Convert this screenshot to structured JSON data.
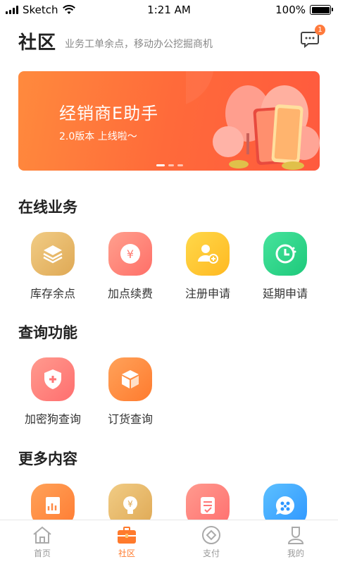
{
  "status_bar": {
    "carrier": "Sketch",
    "time": "1:21 AM",
    "battery": "100%"
  },
  "header": {
    "title": "社区",
    "subtitle": "业务工单余点，移动办公挖掘商机",
    "message_badge": "1"
  },
  "banner": {
    "title": "经销商E助手",
    "subtitle": "2.0版本 上线啦～"
  },
  "sections": {
    "online": {
      "title": "在线业务",
      "items": [
        {
          "label": "库存余点",
          "icon": "layers-icon",
          "color": "#e9b969"
        },
        {
          "label": "加点续费",
          "icon": "yen-coin-icon",
          "color": "#ff8679"
        },
        {
          "label": "注册申请",
          "icon": "add-user-icon",
          "color": "#ffc531"
        },
        {
          "label": "延期申请",
          "icon": "clock-icon",
          "color": "#2ed889"
        }
      ]
    },
    "query": {
      "title": "查询功能",
      "items": [
        {
          "label": "加密狗查询",
          "icon": "shield-plus-icon",
          "color": "#ff7d7d"
        },
        {
          "label": "订货查询",
          "icon": "box-icon",
          "color": "#ff8f45"
        }
      ]
    },
    "more": {
      "title": "更多内容",
      "items": [
        {
          "label": "",
          "icon": "report-icon",
          "color": "#ff8a45"
        },
        {
          "label": "",
          "icon": "bulb-yen-icon",
          "color": "#e9b969"
        },
        {
          "label": "",
          "icon": "checklist-icon",
          "color": "#ff8679"
        },
        {
          "label": "",
          "icon": "chat-app-icon",
          "color": "#4ab0ff"
        }
      ]
    }
  },
  "tabbar": [
    {
      "label": "首页",
      "icon": "home-icon",
      "active": false
    },
    {
      "label": "社区",
      "icon": "briefcase-icon",
      "active": true
    },
    {
      "label": "支付",
      "icon": "pay-icon",
      "active": false
    },
    {
      "label": "我的",
      "icon": "profile-icon",
      "active": false
    }
  ]
}
